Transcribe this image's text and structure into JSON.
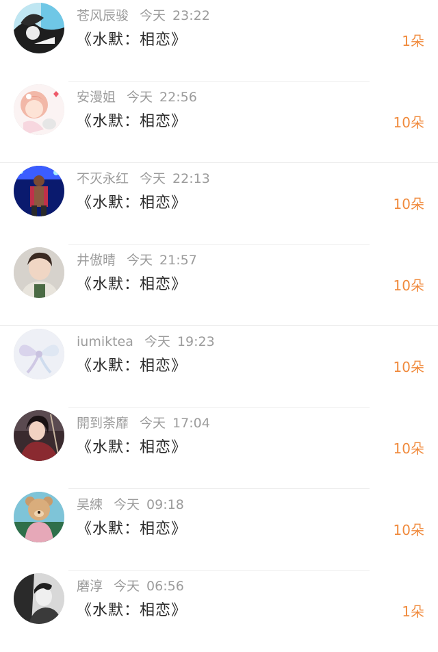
{
  "entries": [
    {
      "name": "苍风辰骏",
      "day": "今天",
      "time": "23:22",
      "title": "《水默：相恋》",
      "count": "1朵",
      "avatar": "avatar-anime-sky"
    },
    {
      "name": "安漫姐",
      "day": "今天",
      "time": "22:56",
      "title": "《水默：相恋》",
      "count": "10朵",
      "avatar": "avatar-anime-girl"
    },
    {
      "name": "不灭永红",
      "day": "今天",
      "time": "22:13",
      "title": "《水默：相恋》",
      "count": "10朵",
      "avatar": "avatar-stage-performer"
    },
    {
      "name": "井傲晴",
      "day": "今天",
      "time": "21:57",
      "title": "《水默：相恋》",
      "count": "10朵",
      "avatar": "avatar-young-man"
    },
    {
      "name": "iumiktea",
      "day": "今天",
      "time": "19:23",
      "title": "《水默：相恋》",
      "count": "10朵",
      "avatar": "avatar-bow"
    },
    {
      "name": "開到荼靡",
      "day": "今天",
      "time": "17:04",
      "title": "《水默：相恋》",
      "count": "10朵",
      "avatar": "avatar-costume-woman"
    },
    {
      "name": "吴綀",
      "day": "今天",
      "time": "09:18",
      "title": "《水默：相恋》",
      "count": "10朵",
      "avatar": "avatar-teddy-bear"
    },
    {
      "name": "磨淳",
      "day": "今天",
      "time": "06:56",
      "title": "《水默：相恋》",
      "count": "1朵",
      "avatar": "avatar-couple-bw"
    }
  ],
  "colors": {
    "name_text": "#9c9c9c",
    "title_text": "#2a2a2a",
    "count_text": "#f08a3c",
    "divider": "#ececec"
  }
}
